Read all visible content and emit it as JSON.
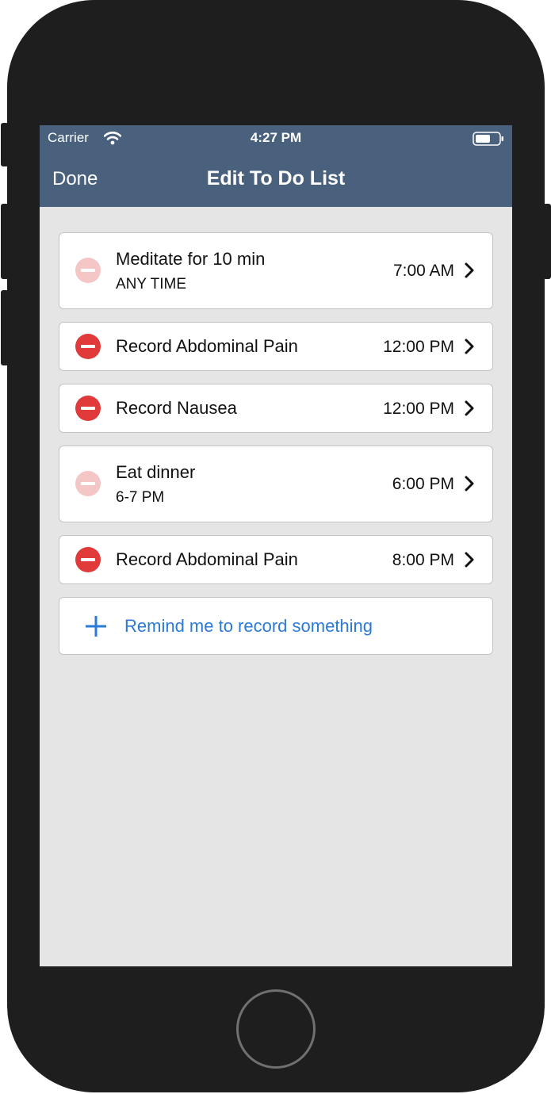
{
  "status_bar": {
    "carrier": "Carrier",
    "time": "4:27 PM",
    "wifi_icon": "wifi-icon",
    "battery_icon": "battery-icon"
  },
  "nav": {
    "done_label": "Done",
    "title": "Edit To Do List"
  },
  "colors": {
    "nav_bg": "#4a617e",
    "screen_bg": "#e5e5e5",
    "delete_active": "#e03a3a",
    "delete_disabled": "#f4c6c6",
    "link_blue": "#2a7ad6"
  },
  "items": [
    {
      "title": "Meditate for 10 min",
      "subtitle": "ANY TIME",
      "time": "7:00 AM",
      "delete_enabled": false,
      "icon": "remove-disabled-icon"
    },
    {
      "title": "Record Abdominal Pain",
      "subtitle": "",
      "time": "12:00 PM",
      "delete_enabled": true,
      "icon": "remove-icon"
    },
    {
      "title": "Record Nausea",
      "subtitle": "",
      "time": "12:00 PM",
      "delete_enabled": true,
      "icon": "remove-icon"
    },
    {
      "title": "Eat dinner",
      "subtitle": "6-7 PM",
      "time": "6:00 PM",
      "delete_enabled": false,
      "icon": "remove-disabled-icon"
    },
    {
      "title": "Record Abdominal Pain",
      "subtitle": "",
      "time": "8:00 PM",
      "delete_enabled": true,
      "icon": "remove-icon"
    }
  ],
  "add_reminder": {
    "label": "Remind me to record something",
    "icon": "plus-icon"
  }
}
